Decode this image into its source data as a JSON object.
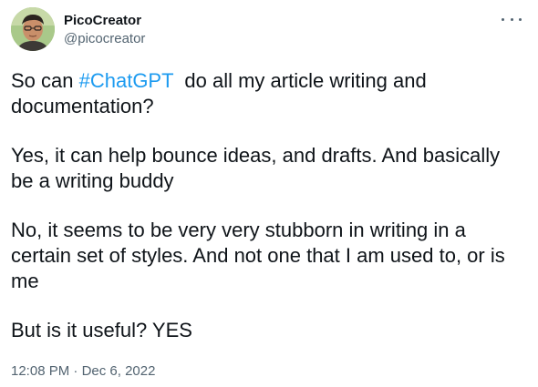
{
  "author": {
    "display_name": "PicoCreator",
    "handle": "@picocreator",
    "avatar_icon": "profile-photo"
  },
  "menu_icon": "more-horizontal-icon",
  "tweet": {
    "p1_before": "So can ",
    "hashtag": "#ChatGPT",
    "p1_after": "  do all my article writing and documentation?",
    "p2": "Yes, it can help bounce ideas, and drafts. And basically be a writing buddy",
    "p3": "No, it seems to be very very stubborn in writing in a certain set of styles. And not one that I am used to, or is me",
    "p4": "But is it useful? YES"
  },
  "meta": {
    "time": "12:08 PM",
    "separator": " · ",
    "date": "Dec 6, 2022"
  },
  "colors": {
    "link": "#1d9bf0",
    "text": "#0f1419",
    "secondary": "#536471"
  }
}
